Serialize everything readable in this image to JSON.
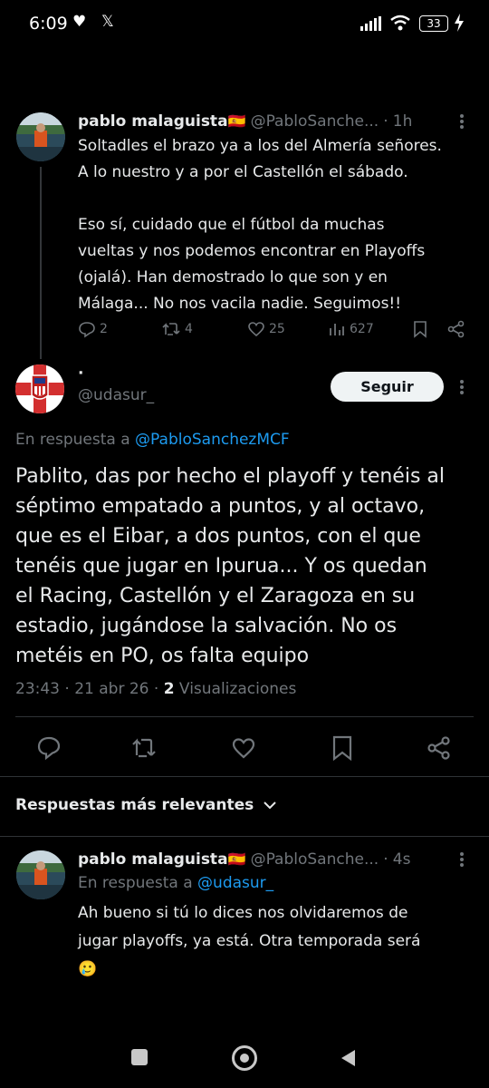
{
  "status_bar": {
    "time": "6:09",
    "battery": "33"
  },
  "tweet1": {
    "name": "pablo malaguista",
    "flag": "🇪🇸",
    "handle": "@PabloSanche...",
    "separator": "·",
    "time": "1h",
    "text_lines": [
      "Soltadles el brazo ya a los del Almería señores.",
      "A lo nuestro y a por el Castellón el sábado.",
      "",
      "Eso sí, cuidado que el fútbol da muchas",
      "vueltas y nos podemos encontrar en Playoffs",
      "(ojalá). Han demostrado lo que son y en",
      "Málaga... No nos vacila nadie. Seguimos!!"
    ],
    "replies": "2",
    "retweets": "4",
    "likes": "25",
    "views": "627"
  },
  "main_tweet": {
    "name": "·",
    "handle": "@udasur_",
    "follow_label": "Seguir",
    "reply_prefix": "En respuesta a ",
    "reply_to": "@PabloSanchezMCF",
    "text_lines": [
      "Pablito, das por hecho el playoff y tenéis al",
      "séptimo empatado a puntos, y al octavo,",
      "que es el Eibar, a dos puntos, con el que",
      "tenéis que jugar en Ipurua... Y os quedan",
      "el Racing, Castellón y el Zaragoza en su",
      "estadio, jugándose la salvación. No os",
      "metéis en PO, os falta equipo"
    ],
    "timestamp": "23:43 · 21 abr 26 · ",
    "views_count": "2",
    "views_label": " Visualizaciones"
  },
  "replies_section": {
    "label": "Respuestas más relevantes"
  },
  "reply_tweet": {
    "name": "pablo malaguista",
    "flag": "🇪🇸",
    "handle": "@PabloSanche...",
    "separator": "·",
    "time": "4s",
    "reply_prefix": "En respuesta a ",
    "reply_to": "@udasur_",
    "text_lines": [
      "Ah bueno si tú lo dices nos olvidaremos de",
      "jugar playoffs, ya está. Otra temporada será",
      "🥲"
    ]
  },
  "colors": {
    "background": "#000000",
    "text": "#e7e9ea",
    "secondary": "#71767b",
    "link": "#1d9bf0"
  }
}
